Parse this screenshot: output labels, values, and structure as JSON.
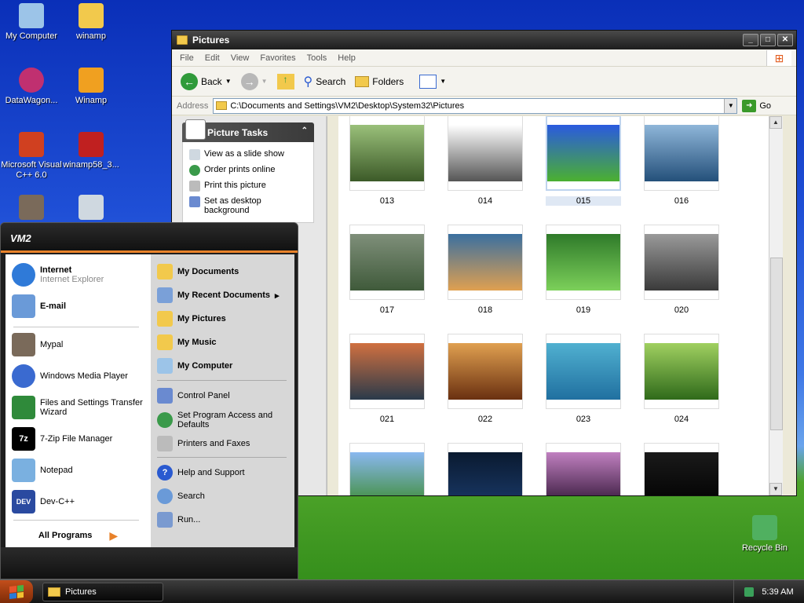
{
  "desktop": {
    "icons": [
      {
        "label": "My Computer",
        "icon": "my-computer-icon",
        "color": "#9cc4e8"
      },
      {
        "label": "winamp",
        "icon": "folder-icon",
        "color": "#f2c94c"
      },
      {
        "label": "DataWagon...",
        "icon": "datawagon-icon",
        "color": "#c03070"
      },
      {
        "label": "Winamp",
        "icon": "winamp-icon",
        "color": "#f0a020"
      },
      {
        "label": "Microsoft Visual C++ 6.0",
        "icon": "visual-cpp-icon",
        "color": "#d04020"
      },
      {
        "label": "winamp58_3...",
        "icon": "winamp-installer-icon",
        "color": "#c02020"
      },
      {
        "label": "Recycle Bin",
        "icon": "recycle-bin-icon",
        "color": "#50b060"
      }
    ]
  },
  "explorer": {
    "title": "Pictures",
    "menu": [
      "File",
      "Edit",
      "View",
      "Favorites",
      "Tools",
      "Help"
    ],
    "toolbar": {
      "back": "Back",
      "search": "Search",
      "folders": "Folders"
    },
    "address_label": "Address",
    "address_value": "C:\\Documents and Settings\\VM2\\Desktop\\System32\\Pictures",
    "go_label": "Go",
    "picture_tasks": {
      "title": "Picture Tasks",
      "items": [
        "View as a slide show",
        "Order prints online",
        "Print this picture",
        "Set as desktop background"
      ]
    },
    "thumbnails": [
      {
        "name": "013",
        "colors": [
          "#9ac07a",
          "#3c5a28"
        ]
      },
      {
        "name": "014",
        "colors": [
          "#ffffff",
          "#555555"
        ]
      },
      {
        "name": "015",
        "colors": [
          "#2a5adf",
          "#4bb030"
        ],
        "selected": true
      },
      {
        "name": "016",
        "colors": [
          "#8fb6d9",
          "#24507a"
        ]
      },
      {
        "name": "017",
        "colors": [
          "#7f8f7a",
          "#3f5a3a"
        ]
      },
      {
        "name": "018",
        "colors": [
          "#3a6fa0",
          "#e0a050"
        ]
      },
      {
        "name": "019",
        "colors": [
          "#2f7a2a",
          "#7cd05a"
        ]
      },
      {
        "name": "020",
        "colors": [
          "#9a9a9a",
          "#3a3a3a"
        ]
      },
      {
        "name": "021",
        "colors": [
          "#d07040",
          "#2a3a4a"
        ]
      },
      {
        "name": "022",
        "colors": [
          "#e0a050",
          "#6a3010"
        ]
      },
      {
        "name": "023",
        "colors": [
          "#50b0d0",
          "#2070a0"
        ]
      },
      {
        "name": "024",
        "colors": [
          "#a0d060",
          "#2f6a1a"
        ]
      },
      {
        "name": "",
        "colors": [
          "#8ab8f0",
          "#3a8a2a"
        ]
      },
      {
        "name": "",
        "colors": [
          "#0a1a30",
          "#1a3a6a"
        ]
      },
      {
        "name": "",
        "colors": [
          "#c080c0",
          "#2a1030"
        ]
      },
      {
        "name": "",
        "colors": [
          "#1a1a1a",
          "#000000"
        ]
      }
    ]
  },
  "start_menu": {
    "user": "VM2",
    "pinned": [
      {
        "label": "Internet",
        "sub": "Internet Explorer",
        "icon": "internet-explorer-icon",
        "color": "#2f7ad8"
      },
      {
        "label": "E-mail",
        "sub": "",
        "icon": "email-icon",
        "color": "#6a9ad8"
      }
    ],
    "recent": [
      {
        "label": "Mypal",
        "icon": "mypal-icon",
        "color": "#7a6a5a"
      },
      {
        "label": "Windows Media Player",
        "icon": "media-player-icon",
        "color": "#3a6ad0"
      },
      {
        "label": "Files and Settings Transfer Wizard",
        "icon": "transfer-wizard-icon",
        "color": "#2f8a3a"
      },
      {
        "label": "7-Zip File Manager",
        "icon": "7zip-icon",
        "color": "#000000"
      },
      {
        "label": "Notepad",
        "icon": "notepad-icon",
        "color": "#7ab0e0"
      },
      {
        "label": "Dev-C++",
        "icon": "devcpp-icon",
        "color": "#2a4aa0"
      }
    ],
    "all_programs": "All Programs",
    "places": [
      {
        "label": "My Documents",
        "icon": "my-documents-icon",
        "color": "#f2c94c",
        "bold": true
      },
      {
        "label": "My Recent Documents",
        "icon": "recent-documents-icon",
        "color": "#7aa0d8",
        "bold": true,
        "arrow": "▸"
      },
      {
        "label": "My Pictures",
        "icon": "my-pictures-icon",
        "color": "#f2c94c",
        "bold": true
      },
      {
        "label": "My Music",
        "icon": "my-music-icon",
        "color": "#f2c94c",
        "bold": true
      },
      {
        "label": "My Computer",
        "icon": "my-computer-icon",
        "color": "#9cc4e8",
        "bold": true
      },
      {
        "label": "Control Panel",
        "icon": "control-panel-icon",
        "color": "#6a8ad0",
        "bold": false
      },
      {
        "label": "Set Program Access and Defaults",
        "icon": "program-access-icon",
        "color": "#3a9a4a",
        "bold": false
      },
      {
        "label": "Printers and Faxes",
        "icon": "printer-icon",
        "color": "#bbbbbb",
        "bold": false
      },
      {
        "label": "Help and Support",
        "icon": "help-icon",
        "color": "#2a5ad0",
        "bold": false
      },
      {
        "label": "Search",
        "icon": "search-icon",
        "color": "#6a9ad8",
        "bold": false
      },
      {
        "label": "Run...",
        "icon": "run-icon",
        "color": "#7a9ad0",
        "bold": false
      }
    ]
  },
  "taskbar": {
    "task": "Pictures",
    "time": "5:39 AM"
  }
}
